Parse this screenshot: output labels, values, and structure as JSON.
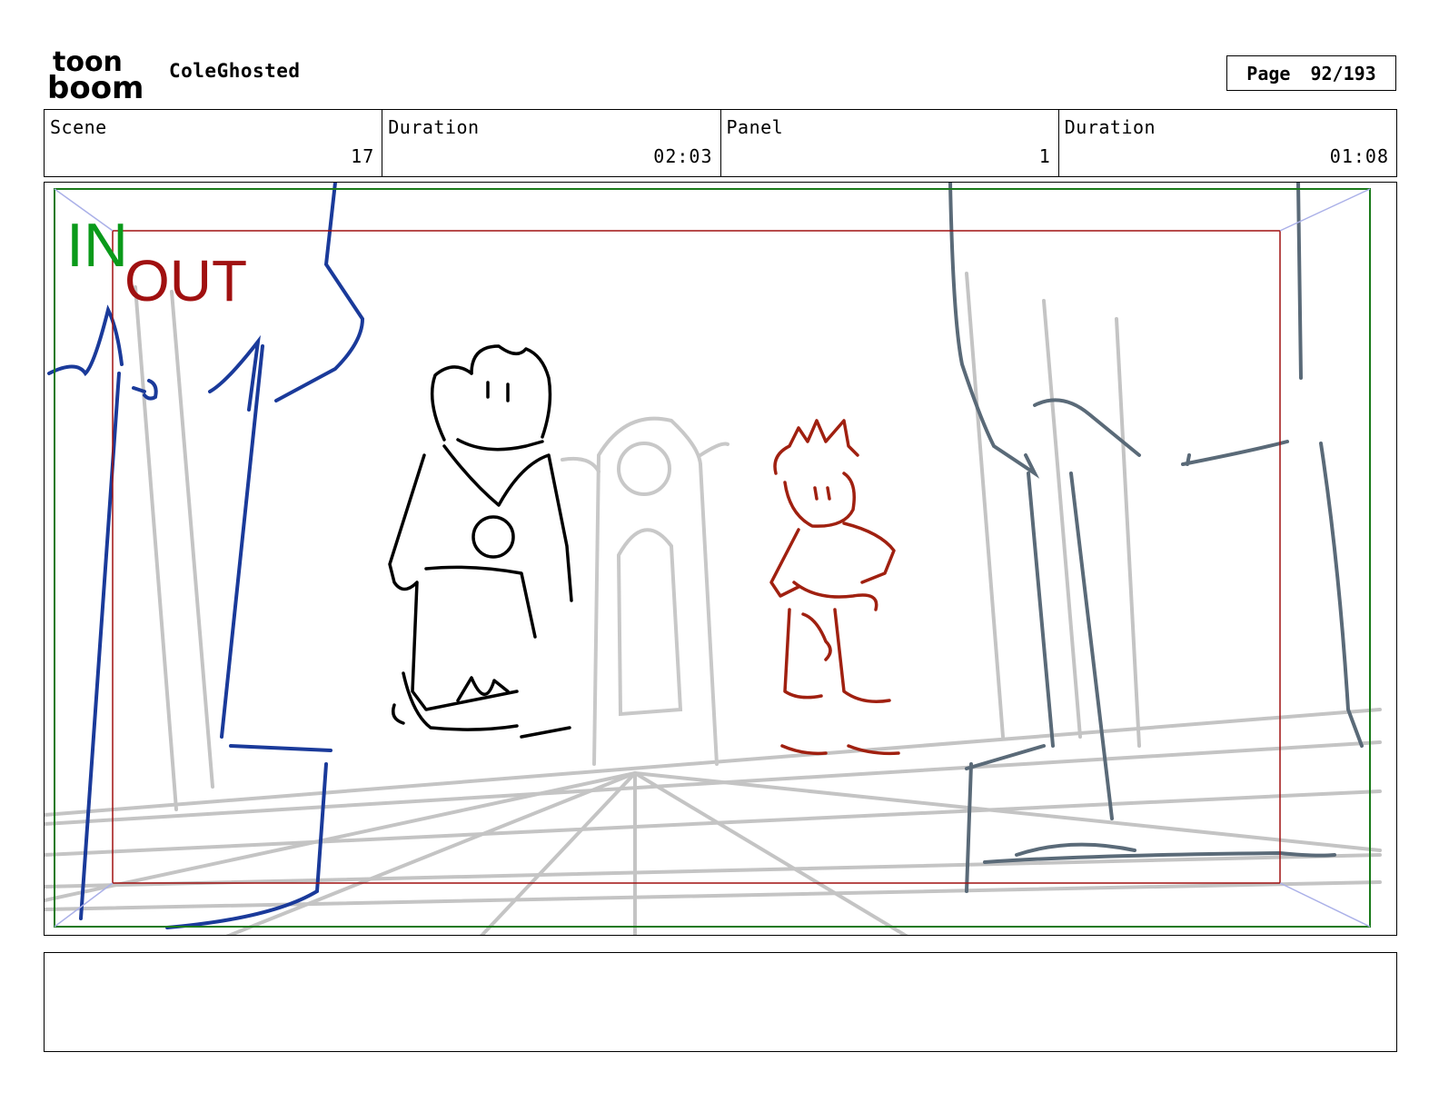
{
  "header": {
    "logo": {
      "line1": "toon",
      "line2": "boom"
    },
    "project_title": "ColeGhosted",
    "page_label": "Page",
    "page_number": "92/193"
  },
  "info": {
    "scene_label": "Scene",
    "scene_value": "17",
    "scene_duration_label": "Duration",
    "scene_duration_value": "02:03",
    "panel_label": "Panel",
    "panel_value": "1",
    "panel_duration_label": "Duration",
    "panel_duration_value": "01:08"
  },
  "panel": {
    "in_label": "IN",
    "out_label": "OUT",
    "in_color": "#0a9a1a",
    "out_color": "#a01010",
    "scribble_text": "yc"
  },
  "notes": {
    "text": ""
  }
}
